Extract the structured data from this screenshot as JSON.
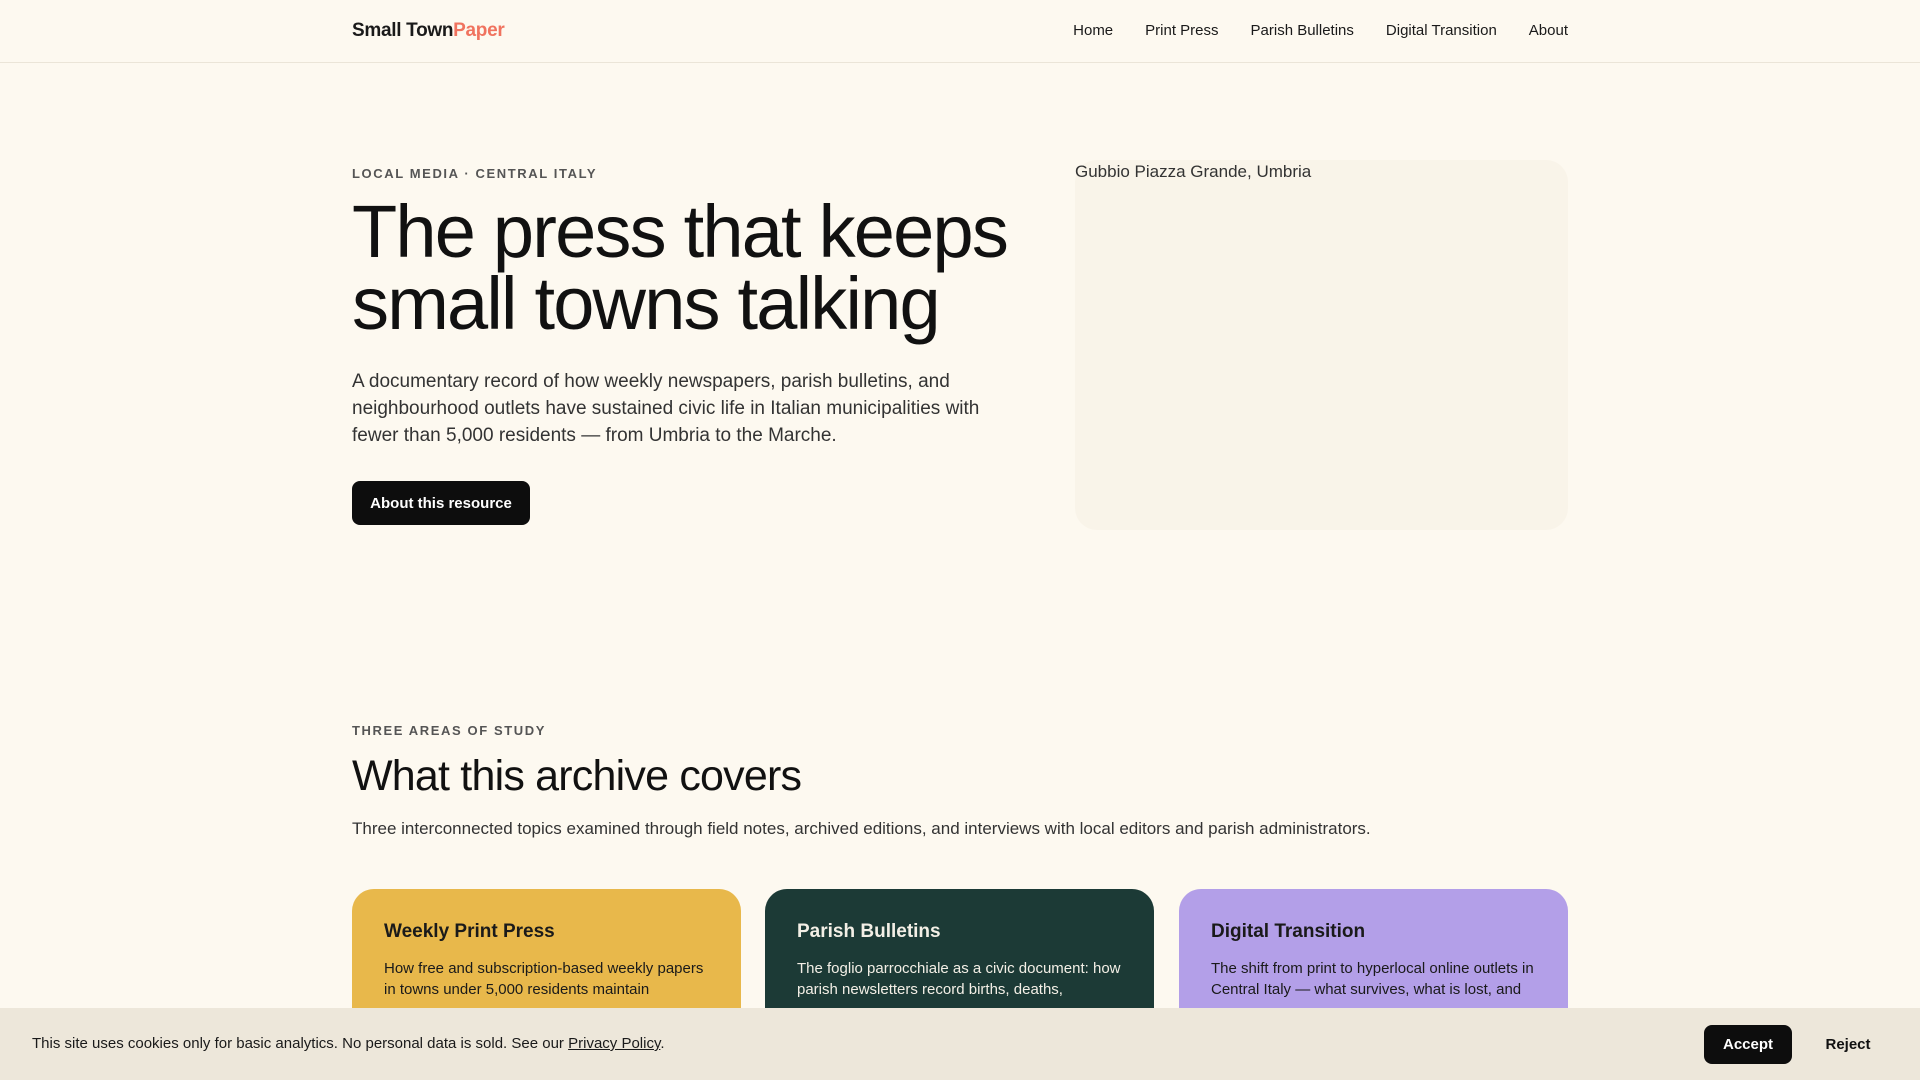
{
  "header": {
    "brand_main": "Small Town",
    "brand_accent": "Paper",
    "nav": [
      "Home",
      "Print Press",
      "Parish Bulletins",
      "Digital Transition",
      "About"
    ]
  },
  "hero": {
    "eyebrow": "LOCAL MEDIA · CENTRAL ITALY",
    "title": "The press that keeps small towns talking",
    "description": "A documentary record of how weekly newspapers, parish bulletins, and neighbourhood outlets have sustained civic life in Italian municipalities with fewer than 5,000 residents — from Umbria to the Marche.",
    "cta_label": "About this resource",
    "image_alt": "Gubbio Piazza Grande, Umbria"
  },
  "section": {
    "eyebrow": "THREE AREAS OF STUDY",
    "title": "What this archive covers",
    "description": "Three interconnected topics examined through field notes, archived editions, and interviews with local editors and parish administrators.",
    "cards": [
      {
        "title": "Weekly Print Press",
        "text": "How free and subscription-based weekly papers in towns under 5,000 residents maintain"
      },
      {
        "title": "Parish Bulletins",
        "text": "The foglio parrocchiale as a civic document: how parish newsletters record births, deaths,"
      },
      {
        "title": "Digital Transition",
        "text": "The shift from print to hyperlocal online outlets in Central Italy — what survives, what is lost, and"
      }
    ]
  },
  "cookie": {
    "text_before": "This site uses cookies only for basic analytics. No personal data is sold. See our ",
    "link_label": "Privacy Policy",
    "text_after": ".",
    "accept_label": "Accept",
    "reject_label": "Reject"
  },
  "colors": {
    "background": "#fdf9f0",
    "brand_accent": "#f0735f",
    "card_yellow": "#e8b84b",
    "card_green": "#1c3a36",
    "card_purple": "#b39fe8"
  }
}
